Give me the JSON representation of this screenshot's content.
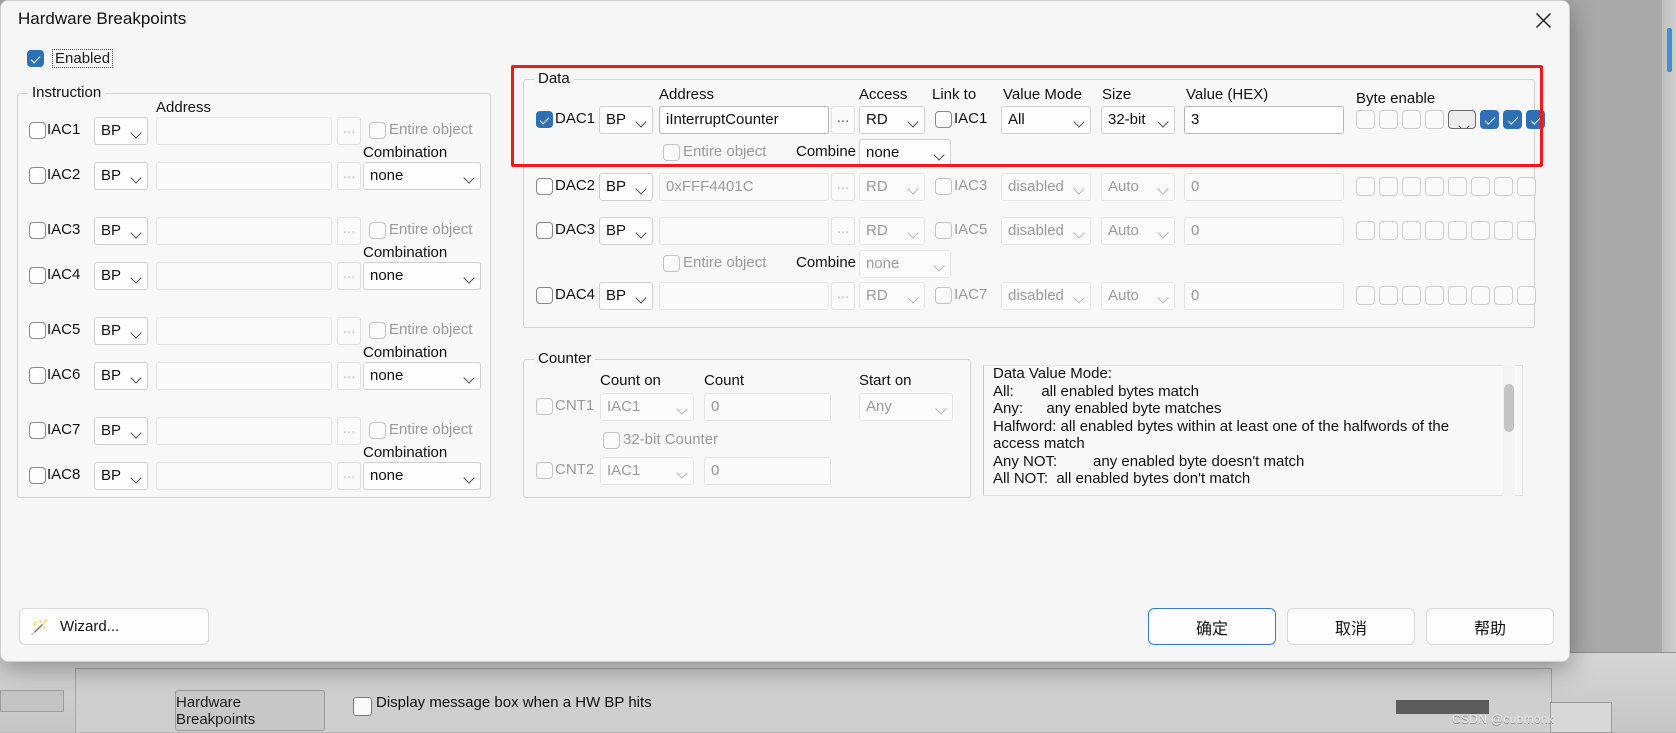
{
  "window": {
    "title": "Hardware Breakpoints",
    "close_icon": "close-icon"
  },
  "enabled": {
    "label": "Enabled",
    "checked": true
  },
  "instruction": {
    "legend": "Instruction",
    "headers": {
      "address": "Address",
      "entire_object": "Entire object",
      "combination": "Combination"
    },
    "rows": [
      {
        "name": "IAC1",
        "checked": false,
        "type": "BP",
        "address": "",
        "browse": "...",
        "entire_object": false
      },
      {
        "name": "IAC2",
        "checked": false,
        "type": "BP",
        "address": "",
        "browse": "...",
        "combination": "none"
      },
      {
        "name": "IAC3",
        "checked": false,
        "type": "BP",
        "address": "",
        "browse": "...",
        "entire_object": false
      },
      {
        "name": "IAC4",
        "checked": false,
        "type": "BP",
        "address": "",
        "browse": "...",
        "combination": "none"
      },
      {
        "name": "IAC5",
        "checked": false,
        "type": "BP",
        "address": "",
        "browse": "...",
        "entire_object": false
      },
      {
        "name": "IAC6",
        "checked": false,
        "type": "BP",
        "address": "",
        "browse": "...",
        "combination": "none"
      },
      {
        "name": "IAC7",
        "checked": false,
        "type": "BP",
        "address": "",
        "browse": "...",
        "entire_object": false
      },
      {
        "name": "IAC8",
        "checked": false,
        "type": "BP",
        "address": "",
        "browse": "...",
        "combination": "none"
      }
    ]
  },
  "data_section": {
    "legend": "Data",
    "headers": {
      "address": "Address",
      "access": "Access",
      "link_to": "Link to",
      "value_mode": "Value Mode",
      "size": "Size",
      "value_hex": "Value (HEX)",
      "byte_enable": "Byte enable",
      "entire_object": "Entire object",
      "combine": "Combine"
    },
    "rows": [
      {
        "name": "DAC1",
        "checked": true,
        "type": "BP",
        "address": "iInterruptCounter",
        "browse": "...",
        "access": "RD",
        "link_to": "IAC1",
        "link_checked": false,
        "value_mode": "All",
        "size": "32-bit",
        "value": "3",
        "byte_enable": [
          false,
          false,
          false,
          false,
          "focus",
          true,
          true,
          true
        ],
        "entire_object": false,
        "combine": "none",
        "enabled_row": true
      },
      {
        "name": "DAC2",
        "checked": false,
        "type": "BP",
        "address": "0xFFF4401C",
        "browse": "...",
        "access": "RD",
        "link_to": "IAC3",
        "link_checked": false,
        "value_mode": "disabled",
        "size": "Auto",
        "value": "0",
        "byte_enable": [
          false,
          false,
          false,
          false,
          false,
          false,
          false,
          false
        ],
        "enabled_row": false
      },
      {
        "name": "DAC3",
        "checked": false,
        "type": "BP",
        "address": "",
        "browse": "...",
        "access": "RD",
        "link_to": "IAC5",
        "link_checked": false,
        "value_mode": "disabled",
        "size": "Auto",
        "value": "0",
        "byte_enable": [
          false,
          false,
          false,
          false,
          false,
          false,
          false,
          false
        ],
        "entire_object": false,
        "combine": "none",
        "enabled_row": false
      },
      {
        "name": "DAC4",
        "checked": false,
        "type": "BP",
        "address": "",
        "browse": "...",
        "access": "RD",
        "link_to": "IAC7",
        "link_checked": false,
        "value_mode": "disabled",
        "size": "Auto",
        "value": "0",
        "byte_enable": [
          false,
          false,
          false,
          false,
          false,
          false,
          false,
          false
        ],
        "enabled_row": false
      }
    ]
  },
  "counter": {
    "legend": "Counter",
    "headers": {
      "count_on": "Count on",
      "count": "Count",
      "start_on": "Start on"
    },
    "rows": [
      {
        "name": "CNT1",
        "checked": false,
        "count_on": "IAC1",
        "count": "0",
        "start_on": "Any"
      },
      {
        "name": "CNT2",
        "checked": false,
        "count_on": "IAC1",
        "count": "0"
      }
    ],
    "bit32_label": "32-bit Counter",
    "bit32_checked": false
  },
  "description": "Data Value Mode:\nAll:    all enabled bytes match\nAny:   any enabled byte matches\nHalfword: all enabled bytes within at least one of the halfwords of the\naccess match\nAny NOT:      any enabled byte doesn't match\nAll NOT:  all enabled bytes don't match",
  "footer": {
    "wizard": "Wizard...",
    "wizard_icon": "magic-wand-icon",
    "ok": "确定",
    "cancel": "取消",
    "help": "帮助"
  },
  "background": {
    "button_label": "Hardware Breakpoints",
    "checkbox_label": "Display message box when a HW BP hits",
    "watermark": "CSDN @cubmonk"
  },
  "colors": {
    "accent": "#2f6fb5",
    "highlight": "#ef1b1b",
    "dialog_bg": "#f6f6f6"
  }
}
